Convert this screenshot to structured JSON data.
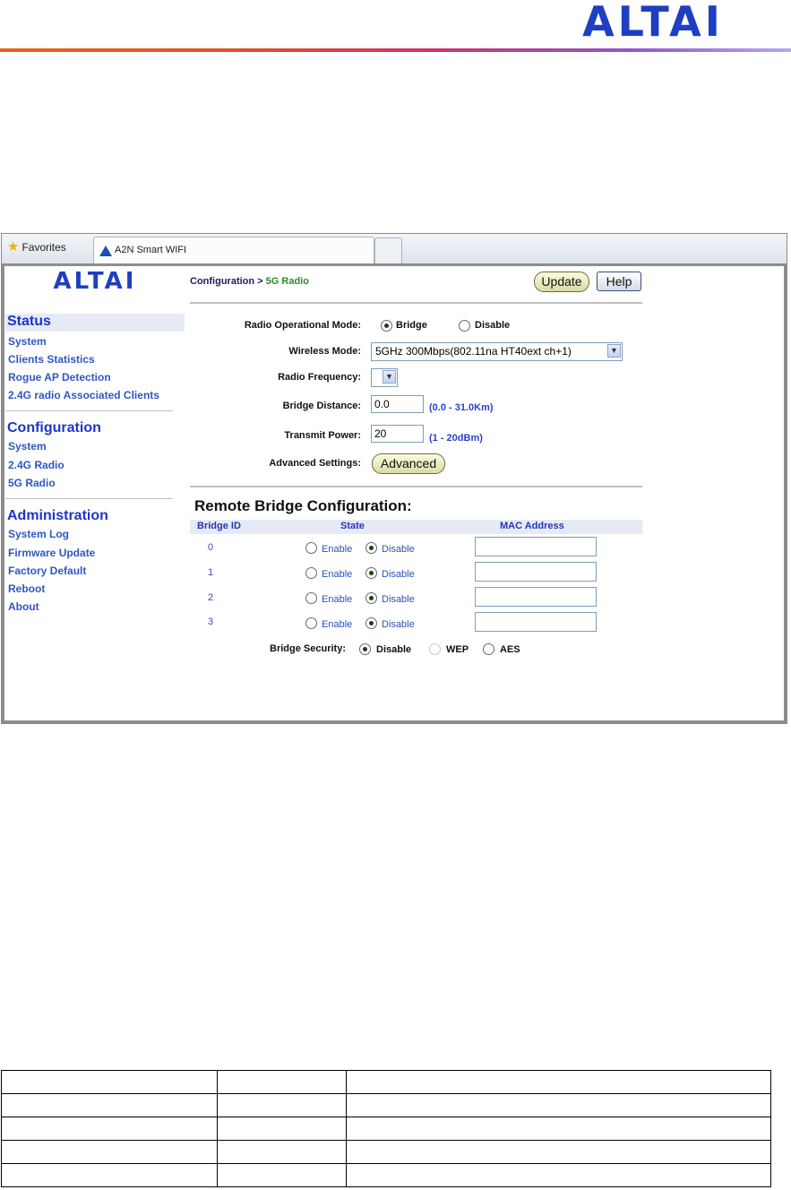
{
  "header": {
    "logo_text": "ALTAI"
  },
  "browser": {
    "favorites_label": "Favorites",
    "tab_title": "A2N Smart WIFI"
  },
  "sidebar": {
    "logo_text": "ALTAI",
    "sections": [
      {
        "title": "Status",
        "items": [
          "System",
          "Clients Statistics",
          "Rogue AP Detection",
          "2.4G radio Associated Clients"
        ]
      },
      {
        "title": "Configuration",
        "items": [
          "System",
          "2.4G Radio",
          "5G Radio"
        ]
      },
      {
        "title": "Administration",
        "items": [
          "System Log",
          "Firmware Update",
          "Factory Default",
          "Reboot",
          "About"
        ]
      }
    ]
  },
  "page": {
    "breadcrumb_parent": "Configuration",
    "breadcrumb_sep": " > ",
    "breadcrumb_current": "5G Radio",
    "update_label": "Update",
    "help_label": "Help"
  },
  "form": {
    "op_mode_label": "Radio Operational Mode:",
    "op_mode_options": [
      "Bridge",
      "Disable"
    ],
    "op_mode_selected": "Bridge",
    "wireless_mode_label": "Wireless Mode:",
    "wireless_mode_value": "5GHz 300Mbps(802.11na HT40ext ch+1)",
    "radio_freq_label": "Radio Frequency:",
    "radio_freq_value": "",
    "bridge_distance_label": "Bridge Distance:",
    "bridge_distance_value": "0.0",
    "bridge_distance_hint": "(0.0 - 31.0Km)",
    "tx_power_label": "Transmit Power:",
    "tx_power_value": "20",
    "tx_power_hint": "(1 - 20dBm)",
    "advanced_label": "Advanced Settings:",
    "advanced_button": "Advanced"
  },
  "remote_bridge": {
    "title": "Remote Bridge Configuration:",
    "columns": [
      "Bridge ID",
      "State",
      "MAC Address"
    ],
    "enable_label": "Enable",
    "disable_label": "Disable",
    "rows": [
      {
        "id": "0",
        "state": "Disable",
        "mac": ""
      },
      {
        "id": "1",
        "state": "Disable",
        "mac": ""
      },
      {
        "id": "2",
        "state": "Disable",
        "mac": ""
      },
      {
        "id": "3",
        "state": "Disable",
        "mac": ""
      }
    ],
    "security_label": "Bridge Security:",
    "security_options": [
      "Disable",
      "WEP",
      "AES"
    ],
    "security_selected": "Disable"
  },
  "colors": {
    "accent_blue": "#1e35c8",
    "link_blue": "#2f57c4",
    "breadcrumb_current": "#2b8a2b"
  }
}
